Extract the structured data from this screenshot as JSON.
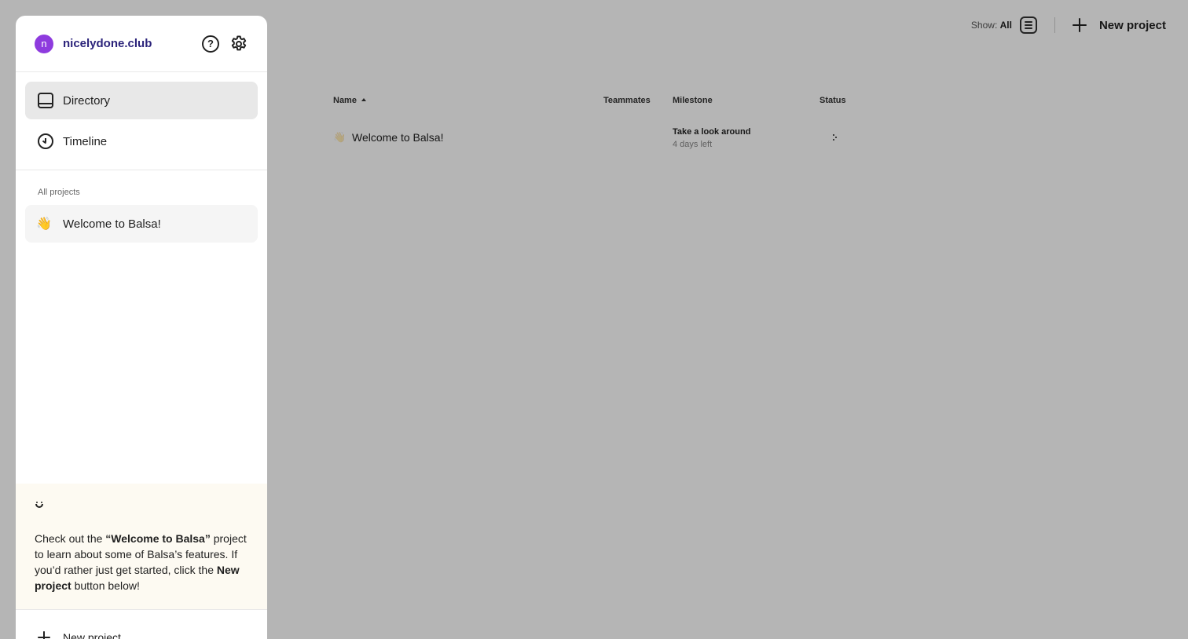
{
  "topbar": {
    "show_label": "Show:",
    "show_value": "All",
    "new_project": "New project"
  },
  "table": {
    "columns": [
      "Name",
      "Teammates",
      "Milestone",
      "Status"
    ],
    "rows": [
      {
        "name": "Welcome to Balsa!",
        "emoji": "👋",
        "milestone_title": "Take a look around",
        "milestone_sub": "4 days left"
      }
    ]
  },
  "drawer": {
    "workspace": {
      "initial": "n",
      "name": "nicelydone.club",
      "avatar_color": "#8e3bde"
    },
    "help_icon_glyph": "?",
    "nav": [
      {
        "label": "Directory",
        "icon": "directory-icon",
        "active": true
      },
      {
        "label": "Timeline",
        "icon": "clock-icon",
        "active": false
      }
    ],
    "section_label": "All projects",
    "projects": [
      {
        "label": "Welcome to Balsa!",
        "emoji": "👋"
      }
    ],
    "tip": {
      "part1": "Check out the ",
      "bold1": "“Welcome to Balsa”",
      "part2": " project to learn about some of Balsa’s features. If you’d rather just get started, click the ",
      "bold2": "New project",
      "part3": " button below!"
    },
    "footer_button": "New project"
  }
}
